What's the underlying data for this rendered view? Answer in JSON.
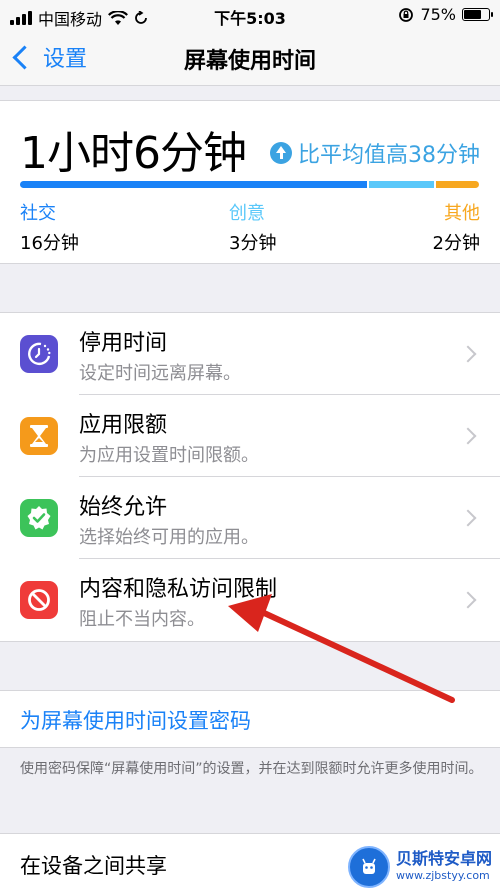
{
  "status_bar": {
    "carrier": "中国移动",
    "time": "下午5:03",
    "battery": "75%",
    "battery_level": 0.75
  },
  "nav": {
    "back_label": "设置",
    "title": "屏幕使用时间"
  },
  "summary": {
    "total_time": "1小时6分钟",
    "compare_text": "比平均值高38分钟",
    "categories": [
      {
        "name": "社交",
        "value": "16分钟",
        "minutes": 16,
        "color": "#1a82f7"
      },
      {
        "name": "创意",
        "value": "3分钟",
        "minutes": 3,
        "color": "#5ac8fa"
      },
      {
        "name": "其他",
        "value": "2分钟",
        "minutes": 2,
        "color": "#f7a71f"
      }
    ]
  },
  "menu": {
    "items": [
      {
        "title": "停用时间",
        "subtitle": "设定时间远离屏幕。",
        "icon": "downtime-icon",
        "color": "#5b4fd1"
      },
      {
        "title": "应用限额",
        "subtitle": "为应用设置时间限额。",
        "icon": "hourglass-icon",
        "color": "#f59a1b"
      },
      {
        "title": "始终允许",
        "subtitle": "选择始终可用的应用。",
        "icon": "checkmark-badge-icon",
        "color": "#3cc35a"
      },
      {
        "title": "内容和隐私访问限制",
        "subtitle": "阻止不当内容。",
        "icon": "restriction-icon",
        "color": "#ef3b39"
      }
    ]
  },
  "passcode": {
    "link_label": "为屏幕使用时间设置密码",
    "footnote": "使用密码保障“屏幕使用时间”的设置，并在达到限额时允许更多使用时间。"
  },
  "share": {
    "label": "在设备之间共享"
  },
  "watermark": {
    "title": "贝斯特安卓网",
    "url": "www.zjbstyy.com"
  }
}
